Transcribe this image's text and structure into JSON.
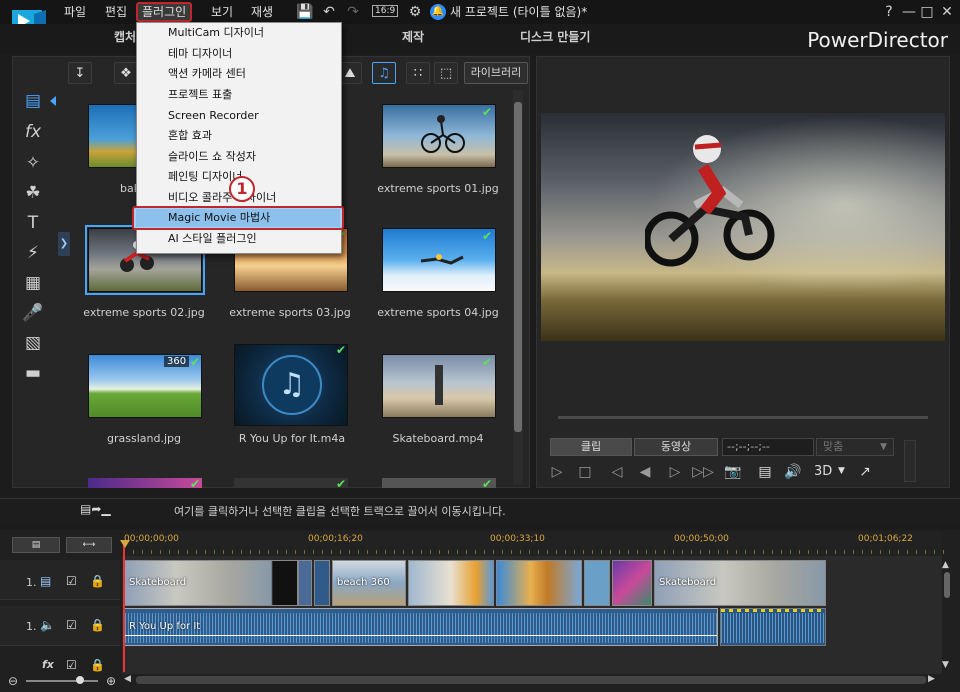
{
  "menu": {
    "file": "파일",
    "edit": "편집",
    "plugins": "플러그인",
    "view": "보기",
    "playback": "재생"
  },
  "toolbar": {
    "aspect": "16:9",
    "project_title": "새 프로젝트 (타이틀 없음)*",
    "help": "?"
  },
  "tabs": {
    "capture": "캡처",
    "produce": "제작",
    "disc": "디스크 만들기"
  },
  "brand": "PowerDirector",
  "library": {
    "dropdown": "라이브러리",
    "items": [
      {
        "label": "bal",
        "check": true
      },
      {
        "label": "",
        "check": true
      },
      {
        "label": "extreme sports 01.jpg",
        "check": true
      },
      {
        "label": "extreme sports 02.jpg",
        "check": false
      },
      {
        "label": "extreme sports 03.jpg",
        "check": true
      },
      {
        "label": "extreme sports 04.jpg",
        "check": true
      },
      {
        "label": "grassland.jpg",
        "check": true,
        "badge": "360"
      },
      {
        "label": "R You Up for It.m4a",
        "check": true
      },
      {
        "label": "Skateboard.mp4",
        "check": true
      }
    ]
  },
  "plugin_menu": {
    "items": [
      "MultiCam 디자이너",
      "테마 디자이너",
      "액션 카메라 센터",
      "프로젝트 표출",
      "Screen Recorder",
      "혼합 효과",
      "슬라이드 쇼 작성자",
      "페인팅 디자이너",
      "비디오 콜라주 디자이너",
      "Magic Movie 마법사",
      "AI 스타일 플러그인"
    ],
    "highlighted_index": 9,
    "step": "1"
  },
  "preview": {
    "clip_tab": "클립",
    "movie_tab": "동영상",
    "timecode": "--;--;--;--",
    "fit": "맞춤",
    "mode_3d": "3D"
  },
  "instruction": "여기를 클릭하거나 선택한 클립을 선택한 트랙으로 끌어서 이동시킵니다.",
  "timeline": {
    "ruler": [
      "00;00;00;00",
      "00;00;16;20",
      "00;00;33;10",
      "00;00;50;00",
      "00;01;06;22"
    ],
    "tracks": [
      {
        "num": "1.",
        "type": "video"
      },
      {
        "num": "1.",
        "type": "audio"
      },
      {
        "num": "fx",
        "type": "effect"
      }
    ],
    "clips": {
      "skateboard_1": "Skateboard",
      "beach": "beach 360",
      "skateboard_2": "Skateboard",
      "audio": "R You Up for It"
    }
  },
  "colors": {
    "highlight_red": "#c0272d",
    "selection_blue": "#4aa3ff",
    "check_green": "#5be35b"
  }
}
